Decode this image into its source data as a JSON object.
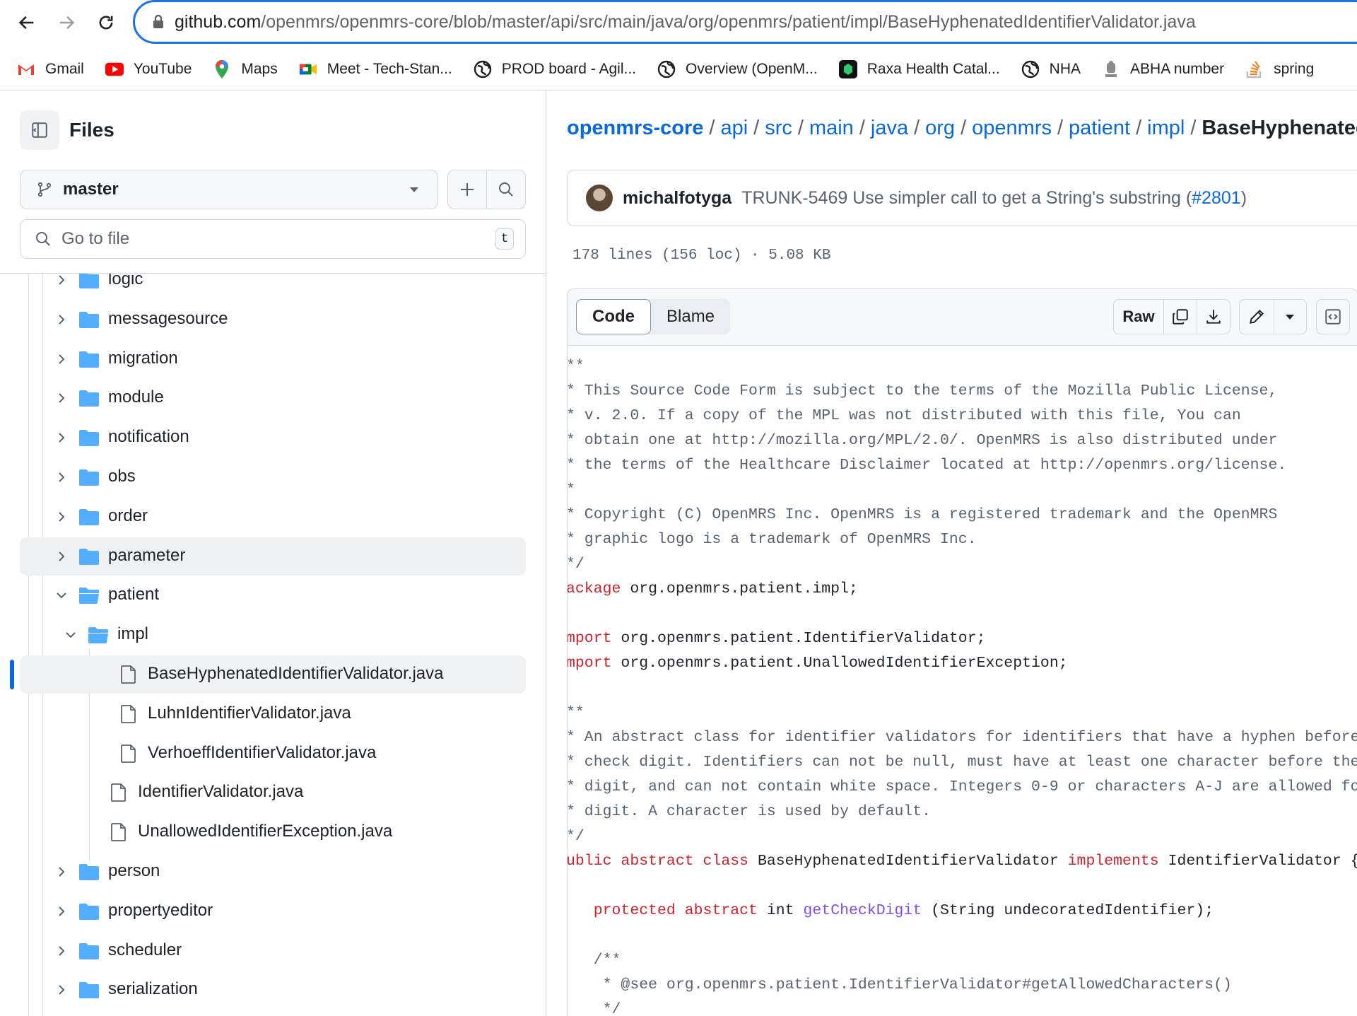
{
  "browser": {
    "url_host": "github.com",
    "url_path": "/openmrs/openmrs-core/blob/master/api/src/main/java/org/openmrs/patient/impl/BaseHyphenatedIdentifierValidator.java",
    "bookmarks": [
      {
        "label": "Gmail",
        "icon": "gmail-icon"
      },
      {
        "label": "YouTube",
        "icon": "youtube-icon"
      },
      {
        "label": "Maps",
        "icon": "maps-icon"
      },
      {
        "label": "Meet - Tech-Stan...",
        "icon": "meet-icon"
      },
      {
        "label": "PROD board - Agil...",
        "icon": "globe-icon"
      },
      {
        "label": "Overview (OpenM...",
        "icon": "globe-icon"
      },
      {
        "label": "Raxa Health Catal...",
        "icon": "raxa-icon"
      },
      {
        "label": "NHA",
        "icon": "globe-icon"
      },
      {
        "label": "ABHA number",
        "icon": "emblem-icon"
      },
      {
        "label": "spring",
        "icon": "stack-icon"
      }
    ]
  },
  "sidebar": {
    "title": "Files",
    "branch": "master",
    "goto_placeholder": "Go to file",
    "goto_shortcut": "t",
    "tree": [
      {
        "label": "logic",
        "type": "folder",
        "expanded": false,
        "depth": 0
      },
      {
        "label": "messagesource",
        "type": "folder",
        "expanded": false,
        "depth": 0
      },
      {
        "label": "migration",
        "type": "folder",
        "expanded": false,
        "depth": 0
      },
      {
        "label": "module",
        "type": "folder",
        "expanded": false,
        "depth": 0
      },
      {
        "label": "notification",
        "type": "folder",
        "expanded": false,
        "depth": 0
      },
      {
        "label": "obs",
        "type": "folder",
        "expanded": false,
        "depth": 0
      },
      {
        "label": "order",
        "type": "folder",
        "expanded": false,
        "depth": 0
      },
      {
        "label": "parameter",
        "type": "folder",
        "expanded": false,
        "depth": 0,
        "hover": true
      },
      {
        "label": "patient",
        "type": "folder",
        "expanded": true,
        "depth": 0
      },
      {
        "label": "impl",
        "type": "folder",
        "expanded": true,
        "depth": 1
      },
      {
        "label": "BaseHyphenatedIdentifierValidator.java",
        "type": "file",
        "depth": 2,
        "selected": true
      },
      {
        "label": "LuhnIdentifierValidator.java",
        "type": "file",
        "depth": 2
      },
      {
        "label": "VerhoeffIdentifierValidator.java",
        "type": "file",
        "depth": 2
      },
      {
        "label": "IdentifierValidator.java",
        "type": "file",
        "depth": 1
      },
      {
        "label": "UnallowedIdentifierException.java",
        "type": "file",
        "depth": 1
      },
      {
        "label": "person",
        "type": "folder",
        "expanded": false,
        "depth": 0
      },
      {
        "label": "propertyeditor",
        "type": "folder",
        "expanded": false,
        "depth": 0
      },
      {
        "label": "scheduler",
        "type": "folder",
        "expanded": false,
        "depth": 0
      },
      {
        "label": "serialization",
        "type": "folder",
        "expanded": false,
        "depth": 0
      }
    ]
  },
  "main": {
    "breadcrumb": [
      "openmrs-core",
      "api",
      "src",
      "main",
      "java",
      "org",
      "openmrs",
      "patient",
      "impl"
    ],
    "breadcrumb_current": "BaseHyphenatedId",
    "commit": {
      "author": "michalfotyga",
      "message": "TRUNK-5469 Use simpler call to get a String's substring (",
      "pr": "#2801",
      "message_end": ")"
    },
    "file_meta": "178 lines (156 loc) · 5.08 KB",
    "tabs": {
      "code": "Code",
      "blame": "Blame"
    },
    "raw_label": "Raw",
    "code_lines": [
      [
        [
          "c",
          "**"
        ]
      ],
      [
        [
          "c",
          "* This Source Code Form is subject to the terms of the Mozilla Public License,"
        ]
      ],
      [
        [
          "c",
          "* v. 2.0. If a copy of the MPL was not distributed with this file, You can"
        ]
      ],
      [
        [
          "c",
          "* obtain one at http://mozilla.org/MPL/2.0/. OpenMRS is also distributed under"
        ]
      ],
      [
        [
          "c",
          "* the terms of the Healthcare Disclaimer located at http://openmrs.org/license."
        ]
      ],
      [
        [
          "c",
          "*"
        ]
      ],
      [
        [
          "c",
          "* Copyright (C) OpenMRS Inc. OpenMRS is a registered trademark and the OpenMRS"
        ]
      ],
      [
        [
          "c",
          "* graphic logo is a trademark of OpenMRS Inc."
        ]
      ],
      [
        [
          "c",
          "*/"
        ]
      ],
      [
        [
          "k",
          "ackage"
        ],
        [
          "",
          "org.openmrs.patient.impl;"
        ]
      ],
      [],
      [
        [
          "k",
          "mport"
        ],
        [
          "",
          "org.openmrs.patient.IdentifierValidator;"
        ]
      ],
      [
        [
          "k",
          "mport"
        ],
        [
          "",
          "org.openmrs.patient.UnallowedIdentifierException;"
        ]
      ],
      [],
      [
        [
          "c",
          "**"
        ]
      ],
      [
        [
          "c",
          "* An abstract class for identifier validators for identifiers that have a hyphen before"
        ]
      ],
      [
        [
          "c",
          "* check digit. Identifiers can not be null, must have at least one character before the"
        ]
      ],
      [
        [
          "c",
          "* digit, and can not contain white space. Integers 0-9 or characters A-J are allowed fo"
        ]
      ],
      [
        [
          "c",
          "* digit. A character is used by default."
        ]
      ],
      [
        [
          "c",
          "*/"
        ]
      ],
      [
        [
          "k",
          "ublic abstract class"
        ],
        [
          "",
          "BaseHyphenatedIdentifierValidator"
        ],
        [
          "k",
          "implements"
        ],
        [
          "",
          "IdentifierValidator {"
        ]
      ],
      [],
      [
        [
          "",
          "   "
        ],
        [
          "k",
          "protected abstract"
        ],
        [
          "",
          "int"
        ],
        [
          "f",
          "getCheckDigit"
        ],
        [
          "",
          "(String undecoratedIdentifier);"
        ]
      ],
      [],
      [
        [
          "c",
          "   /**"
        ]
      ],
      [
        [
          "c",
          "    * @see org.openmrs.patient.IdentifierValidator#getAllowedCharacters()"
        ]
      ],
      [
        [
          "c",
          "    */"
        ]
      ]
    ]
  }
}
